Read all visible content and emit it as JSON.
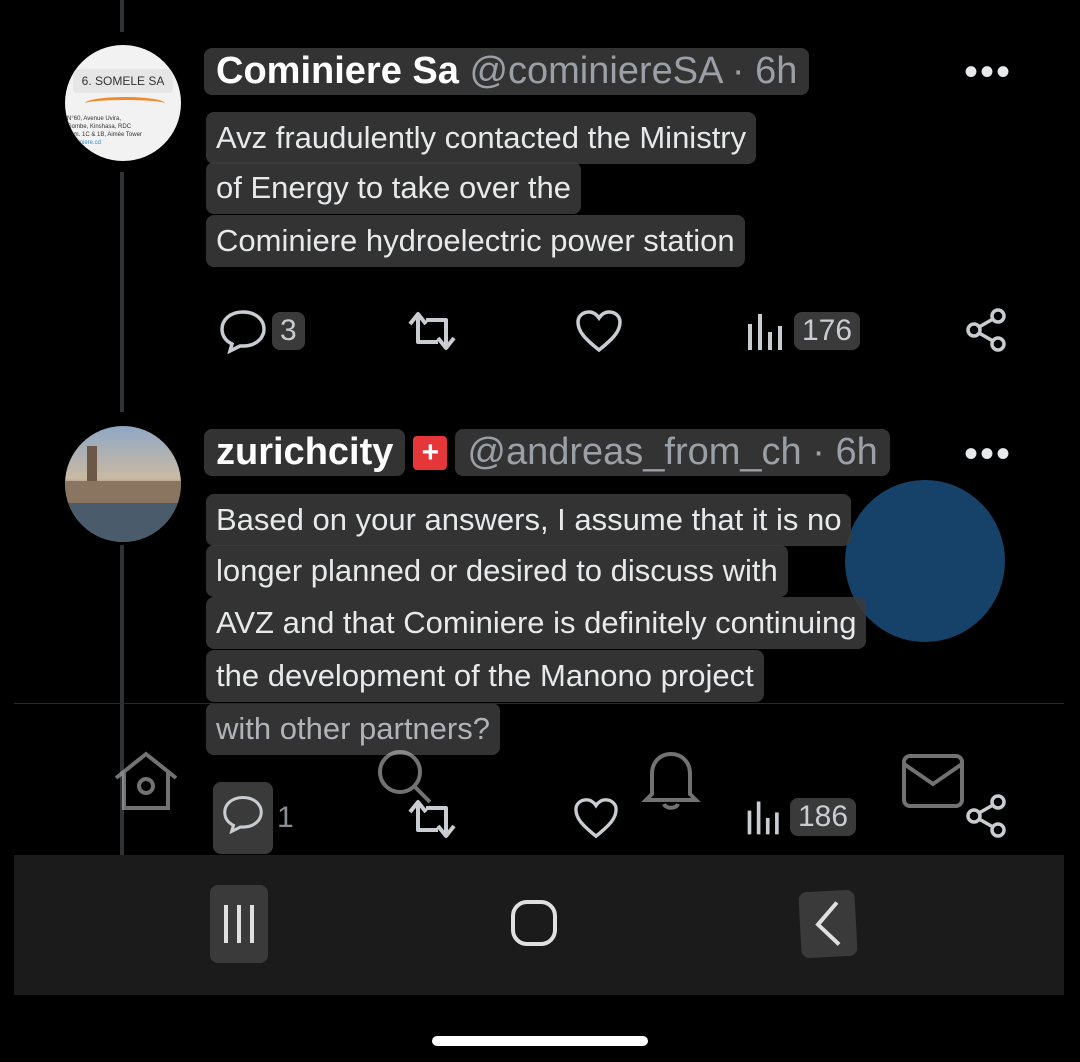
{
  "tweets": [
    {
      "avatar": {
        "label": "6. SOMELE SA",
        "address_lines": [
          "N°60, Avenue Uvira,",
          "Gombe, Kinshasa, RDC",
          "Imm. 1C & 1B, Aimée Tower",
          "cominiere.cd"
        ]
      },
      "name": "Cominiere Sa",
      "handle": "@cominiereSA",
      "time": "· 6h",
      "text_lines": [
        "Avz fraudulently contacted the Ministry",
        "of Energy to take over the",
        "Cominiere hydroelectric power station"
      ],
      "actions": {
        "replies": "3",
        "retweets": "",
        "likes": "",
        "views": "176"
      }
    },
    {
      "name": "zurichcity",
      "flag": "+",
      "handle": "@andreas_from_ch",
      "time": "· 6h",
      "text_lines": [
        "Based on your answers, I assume that it is no",
        "longer planned or desired to discuss with",
        "AVZ and that Cominiere is definitely continuing",
        "the development of the Manono project",
        "with other partners?"
      ],
      "actions": {
        "replies": "1",
        "retweets": "",
        "likes": "",
        "views": "186"
      }
    }
  ],
  "more_label": "•••",
  "colors": {
    "background": "#000000",
    "highlight": "#3c3c3c",
    "flag_red": "#e5363a",
    "blue_blob": "#1a4c7a"
  }
}
